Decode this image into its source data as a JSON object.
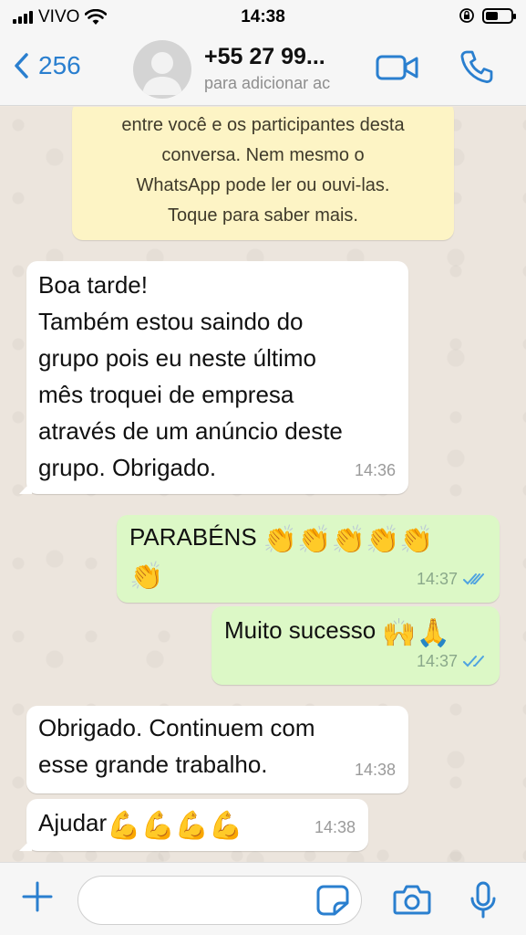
{
  "status_bar": {
    "carrier": "VIVO",
    "time": "14:38",
    "battery_level": 0.5
  },
  "header": {
    "back_count": "256",
    "contact_name": "+55 27 99...",
    "contact_subtitle": "para adicionar ac",
    "icons": {
      "back": "chevron-left-icon",
      "avatar": "person-silhouette",
      "video": "video-camera-icon",
      "call": "phone-icon"
    }
  },
  "notice": {
    "lines": [
      "entre você e os participantes desta",
      "conversa. Nem mesmo o",
      "WhatsApp pode ler ou ouvi-las.",
      "Toque para saber mais."
    ]
  },
  "messages": [
    {
      "direction": "in",
      "lines": [
        "Boa tarde!",
        "Também estou saindo do",
        "grupo pois eu neste último",
        "mês troquei de empresa",
        "através de um anúncio deste",
        "grupo. Obrigado."
      ],
      "time": "14:36"
    },
    {
      "direction": "out",
      "text": "PARABÉNS",
      "emojis": "👏👏👏👏👏",
      "emojis2": "👏",
      "time": "14:37",
      "status": "read"
    },
    {
      "direction": "out",
      "text": "Muito sucesso",
      "emojis": "🙌🙏",
      "time": "14:37",
      "status": "read"
    },
    {
      "direction": "in",
      "lines": [
        "Obrigado. Continuem com",
        "esse grande trabalho."
      ],
      "time": "14:38"
    },
    {
      "direction": "in",
      "text": "Ajudar",
      "emojis": "💪💪💪💪",
      "time": "14:38"
    }
  ],
  "input": {
    "value": "",
    "placeholder": ""
  },
  "colors": {
    "accent": "#2a7fcf",
    "outgoing": "#dcf8c6",
    "incoming": "#ffffff",
    "notice": "#fdf4c5",
    "read_ticks": "#4fa3e0"
  }
}
